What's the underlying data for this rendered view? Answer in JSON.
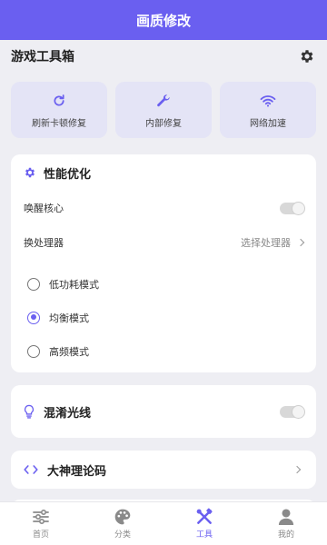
{
  "header": {
    "title": "画质修改"
  },
  "toolbox": {
    "title": "游戏工具箱",
    "settings_icon": "gear-icon"
  },
  "quick_actions": [
    {
      "label": "刷新卡顿修复",
      "icon": "refresh-icon"
    },
    {
      "label": "内部修复",
      "icon": "wrench-icon"
    },
    {
      "label": "网络加速",
      "icon": "wifi-icon"
    }
  ],
  "performance": {
    "title": "性能优化",
    "wake_core_label": "唤醒核心",
    "wake_core_on": false,
    "processor_label": "换处理器",
    "processor_value": "选择处理器",
    "modes": [
      {
        "label": "低功耗模式",
        "selected": false
      },
      {
        "label": "均衡模式",
        "selected": true
      },
      {
        "label": "高频模式",
        "selected": false
      }
    ]
  },
  "ray": {
    "title": "混淆光线",
    "on": false
  },
  "code": {
    "title": "大神理论码"
  },
  "nav": [
    {
      "label": "首页",
      "icon": "sliders-icon",
      "active": false
    },
    {
      "label": "分类",
      "icon": "palette-icon",
      "active": false
    },
    {
      "label": "工具",
      "icon": "tools-icon",
      "active": true
    },
    {
      "label": "我的",
      "icon": "user-icon",
      "active": false
    }
  ],
  "colors": {
    "accent": "#6a5ff0",
    "background": "#eeeef3",
    "card": "#ffffff",
    "tile": "#e4e4f6"
  }
}
